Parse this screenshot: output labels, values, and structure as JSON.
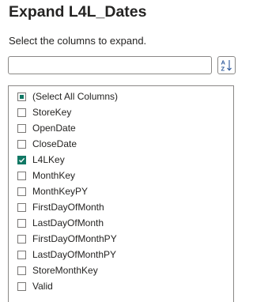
{
  "dialog": {
    "title": "Expand L4L_Dates",
    "subtitle": "Select the columns to expand."
  },
  "search": {
    "value": "",
    "placeholder": ""
  },
  "sort_button": {
    "icon": "sort-az-icon",
    "letters": [
      "A",
      "Z"
    ],
    "color": "#2b579a"
  },
  "accent_color": "#117865",
  "columns": [
    {
      "label": "(Select All Columns)",
      "state": "partial"
    },
    {
      "label": "StoreKey",
      "state": "unchecked"
    },
    {
      "label": "OpenDate",
      "state": "unchecked"
    },
    {
      "label": "CloseDate",
      "state": "unchecked"
    },
    {
      "label": "L4LKey",
      "state": "checked"
    },
    {
      "label": "MonthKey",
      "state": "unchecked"
    },
    {
      "label": "MonthKeyPY",
      "state": "unchecked"
    },
    {
      "label": "FirstDayOfMonth",
      "state": "unchecked"
    },
    {
      "label": "LastDayOfMonth",
      "state": "unchecked"
    },
    {
      "label": "FirstDayOfMonthPY",
      "state": "unchecked"
    },
    {
      "label": "LastDayOfMonthPY",
      "state": "unchecked"
    },
    {
      "label": "StoreMonthKey",
      "state": "unchecked"
    },
    {
      "label": "Valid",
      "state": "unchecked"
    }
  ]
}
